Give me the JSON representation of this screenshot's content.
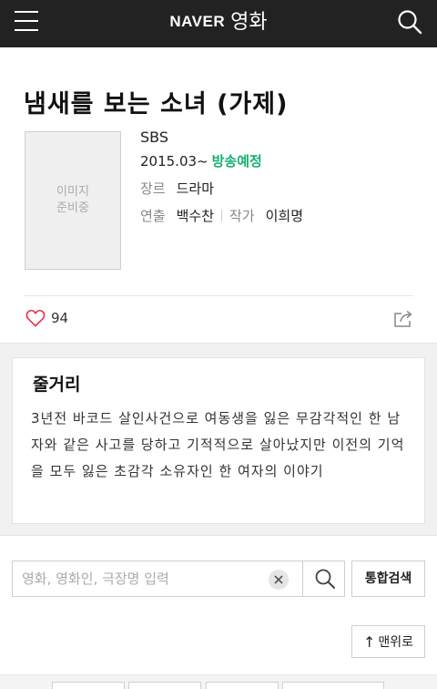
{
  "header": {
    "brand_naver": "NAVER",
    "brand_movie": "영화",
    "menu_icon": "hamburger-menu-icon",
    "search_icon": "search-icon"
  },
  "movie": {
    "title": "냄새를 보는 소녀 (가제)",
    "poster_placeholder_line1": "이미지",
    "poster_placeholder_line2": "준비중",
    "broadcaster": "SBS",
    "date": "2015.03~",
    "status": "방송예정",
    "genre_label": "장르",
    "genre": "드라마",
    "director_label": "연출",
    "director": "백수찬",
    "writer_label": "작가",
    "writer": "이희명",
    "likes": "94"
  },
  "synopsis": {
    "heading": "줄거리",
    "text": "3년전 바코드 살인사건으로 여동생을 잃은 무감각적인 한 남자와 같은 사고를 당하고 기적적으로 살아났지만 이전의 기억을 모두 잃은 초감각 소유자인 한 여자의 이야기"
  },
  "search": {
    "placeholder": "영화, 영화인, 극장명 입력",
    "value": "",
    "total_search_label": "통합검색"
  },
  "footer": {
    "top_button_label": "맨위로",
    "top_button_arrow": "↑"
  },
  "colors": {
    "header_bg": "#222222",
    "status_green": "#15b072",
    "like_red": "#e8344e"
  }
}
